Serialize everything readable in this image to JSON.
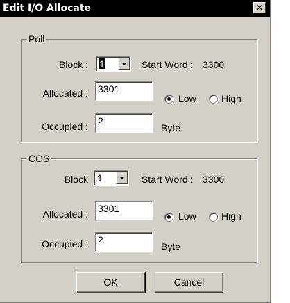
{
  "window": {
    "title": "Edit I/O Allocate",
    "close_glyph": "✕"
  },
  "poll": {
    "group_label": "Poll",
    "block_label": "Block :",
    "block_value": "1",
    "start_word_label": "Start Word :",
    "start_word_value": "3300",
    "allocated_label": "Allocated :",
    "allocated_value": "3301",
    "low_label": "Low",
    "high_label": "High",
    "selected": "Low",
    "occupied_label": "Occupied :",
    "occupied_value": "2",
    "unit_label": "Byte"
  },
  "cos": {
    "group_label": "COS",
    "block_label": "Block",
    "block_value": "1",
    "start_word_label": "Start Word :",
    "start_word_value": "3300",
    "allocated_label": "Allocated :",
    "allocated_value": "3301",
    "low_label": "Low",
    "high_label": "High",
    "selected": "Low",
    "occupied_label": "Occupied :",
    "occupied_value": "2",
    "unit_label": "Byte"
  },
  "buttons": {
    "ok_label": "OK",
    "cancel_label": "Cancel"
  }
}
